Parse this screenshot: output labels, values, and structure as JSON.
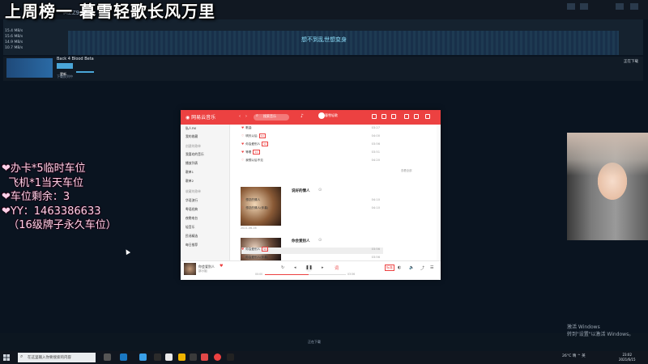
{
  "stream": {
    "title": "上周榜一 暮雪轻歌长风万里",
    "overlay_lines": [
      "❤办卡*5临时车位",
      "  飞机*1当天车位",
      "❤车位剩余：3",
      "❤YY：1463386633",
      "  （16级牌子永久车位）"
    ]
  },
  "steam": {
    "account_label": "MZZ9",
    "stats": [
      "15.4 MB/s",
      "15.6 MB/s",
      "14.9 MB/s",
      "10.7 MB/s"
    ],
    "banner": "想不到乱世想变身",
    "game": {
      "name": "Back 4 Blood Beta",
      "button": "更新",
      "status": "下载队列中"
    },
    "right_label": "正在下载",
    "bottom_label": "正在下载"
  },
  "music_app": {
    "brand": "网易云音乐",
    "search_placeholder": "搜索音乐",
    "user_name": "暮雪轻歌",
    "sidebar": [
      {
        "label": "私人FM",
        "head": false
      },
      {
        "label": "我的收藏",
        "head": false
      },
      {
        "label": "创建的歌单",
        "head": true
      },
      {
        "label": "我喜欢的音乐",
        "head": false
      },
      {
        "label": "播放列表",
        "head": false
      },
      {
        "label": "歌单1",
        "head": false
      },
      {
        "label": "歌单2",
        "head": false
      },
      {
        "label": "收藏的歌单",
        "head": true
      },
      {
        "label": "华语流行",
        "head": false
      },
      {
        "label": "粤语经典",
        "head": false
      },
      {
        "label": "夜晚电台",
        "head": false
      },
      {
        "label": "轻音乐",
        "head": false
      },
      {
        "label": "民谣精选",
        "head": false
      },
      {
        "label": "每日推荐",
        "head": false
      }
    ],
    "top_songs": [
      {
        "title": "歌曲",
        "dur": "03:27"
      },
      {
        "title": "明天以后",
        "dur": "04:00"
      },
      {
        "title": "你会爱别人",
        "dur": "03:56"
      },
      {
        "title": "等着",
        "dur": "03:51"
      },
      {
        "title": "我想以后不见",
        "dur": "04:20"
      }
    ],
    "section1_title": "说好的情人",
    "section1_date": "2021-06-16",
    "section1_songs": [
      {
        "title": "想念的情人",
        "dur": "04:10"
      },
      {
        "title": "想念的情人(伴奏)",
        "dur": "04:10"
      }
    ],
    "section2_title": "你会爱别人",
    "section2_songs": [
      {
        "title": "你会爱别人",
        "dur": "03:56"
      },
      {
        "title": "你会爱别人(伴奏)",
        "dur": "03:56"
      }
    ],
    "more_label": "查看全部",
    "player": {
      "song": "你会爱别人",
      "artist": "邵小姐",
      "time_current": "00:00",
      "time_total": "03:56",
      "quality": "标准",
      "progress": 0.54
    }
  },
  "system": {
    "watermark_line1": "激活 Windows",
    "watermark_line2": "转到\"设置\"以激活 Windows。",
    "search_text": "在这里输入你要搜索的内容",
    "tray_text": "26°C  晴  ^  英",
    "clock_time": "23:02",
    "clock_date": "2021/6/15"
  },
  "colors": {
    "netease_red": "#ec4141",
    "overlay_pink": "#ffd0e8",
    "steam_blue": "#4aa6d8"
  }
}
